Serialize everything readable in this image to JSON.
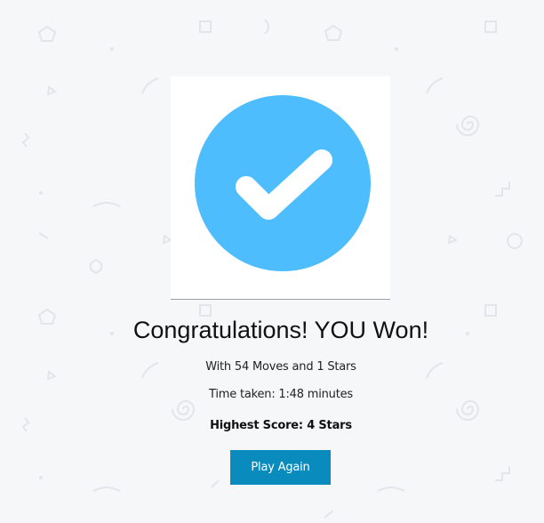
{
  "result": {
    "title": "Congratulations! YOU Won!",
    "moves_text": "With 54 Moves and 1 Stars",
    "time_text": "Time taken: 1:48 minutes",
    "score_text": "Highest Score: 4 Stars",
    "play_again_label": "Play Again",
    "icon": "checkmark-circle-icon"
  },
  "colors": {
    "background": "#f6f7f9",
    "check_circle": "#4dbdfd",
    "button": "#0a8bbd",
    "button_text": "#ffffff"
  }
}
